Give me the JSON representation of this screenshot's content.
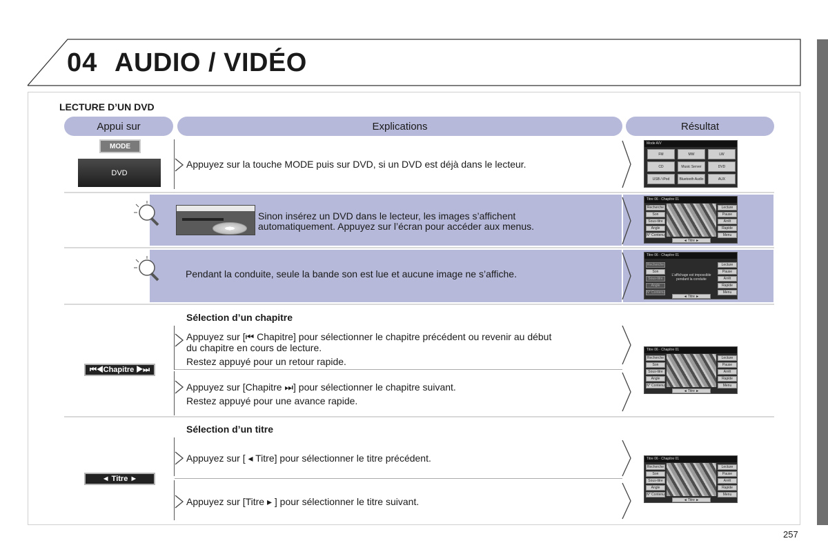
{
  "header": {
    "chapter_number": "04",
    "chapter_title": "AUDIO / VIDÉO"
  },
  "section_title": "LECTURE D’UN DVD",
  "columns": {
    "press": "Appui sur",
    "explanations": "Explications",
    "result": "Résultat"
  },
  "keys": {
    "mode": "MODE",
    "dvd": "DVD",
    "chapter": "⏮◀Chapitre ▶⏭",
    "title": "◄ Titre ►"
  },
  "rows": {
    "row1": "Appuyez sur la touche MODE puis sur DVD, si un DVD est déjà dans le lecteur.",
    "tip1_line1": "Sinon insérez un DVD dans le lecteur, les images s’affichent",
    "tip1_line2": "automatiquement. Appuyez sur l’écran pour accéder aux menus.",
    "tip2": "Pendant la conduite, seule la bande son est lue et aucune image ne s’affiche.",
    "chapter_heading": "Sélection d’un chapitre",
    "chapter_prev_line1": "Appuyez sur [⏮ Chapitre] pour sélectionner le chapitre précédent ou revenir au début",
    "chapter_prev_line2": "du chapitre en cours de lecture.",
    "chapter_prev_line3": "Restez appuyé pour un retour rapide.",
    "chapter_next_line1": "Appuyez sur [Chapitre ⏭] pour sélectionner le chapitre suivant.",
    "chapter_next_line2": "Restez appuyé pour une avance rapide.",
    "title_heading": "Sélection d’un titre",
    "title_prev": "Appuyez sur [ ◂ Titre] pour sélectionner le titre précédent.",
    "title_next": "Appuyez sur [Titre ▸ ] pour sélectionner le titre suivant."
  },
  "screens": {
    "mode_menu": {
      "header": "Mode A/V",
      "buttons": [
        "FM",
        "MW",
        "LW",
        "CD",
        "Music Server",
        "DVD",
        "USB / iPod",
        "Bluetooth Audio",
        "AUX"
      ]
    },
    "player_left": [
      "Recherche",
      "Son",
      "Sous-titre",
      "Angle",
      "N° Contenu"
    ],
    "player_right": [
      "Lecture",
      "Pause",
      "Arrêt",
      "Rapide",
      "Menu"
    ],
    "player_header": "Titre 06 · Chapitre 01",
    "driving_message": "L'affichage est impossible pendant la conduite",
    "bottom_title": "◄ Titre ►"
  },
  "page_number": "257"
}
